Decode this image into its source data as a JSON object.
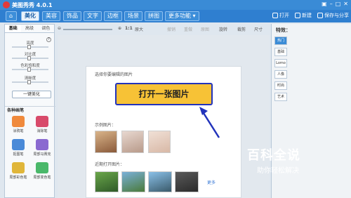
{
  "app": {
    "title": "美图秀秀 4.0.1"
  },
  "menu": {
    "tabs": [
      "美化",
      "美容",
      "饰品",
      "文字",
      "边框",
      "场景",
      "拼图",
      "更多功能 ▾"
    ],
    "open_label": "打开",
    "new_label": "新建",
    "save_label": "保存与分享"
  },
  "left": {
    "subtabs": [
      "基础",
      "高级",
      "调色"
    ],
    "sliders": [
      "亮度",
      "对比度",
      "色彩饱和度",
      "清晰度"
    ],
    "onekey_label": "一键美化",
    "brush_heading": "各种画笔",
    "brushes": [
      "涂鸦笔",
      "消除笔",
      "抠图笔",
      "局部马赛克",
      "局部彩色笔",
      "局部变色笔"
    ]
  },
  "toolbar": {
    "ratio": "1:1",
    "original": "原大",
    "undo": "撤销",
    "redo": "重做",
    "original_image": "原图",
    "rotate": "旋转",
    "crop": "裁剪",
    "size": "尺寸"
  },
  "card": {
    "select_label": "选择你要编辑的图片",
    "open_button": "打开一张图片",
    "examples_label": "示例图片：",
    "recent_label": "近期打开图片：",
    "more_link": "更多"
  },
  "right": {
    "heading": "特效：",
    "tabs": [
      "热门",
      "基础",
      "Lomo",
      "人像",
      "时尚",
      "艺术"
    ]
  },
  "watermark": {
    "title": "百科全说",
    "subtitle": "助你轻松解决"
  }
}
